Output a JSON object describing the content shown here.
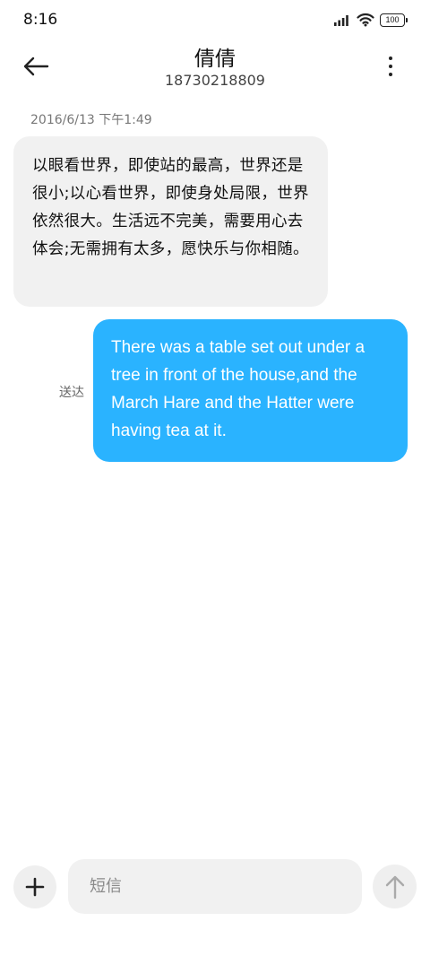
{
  "status_bar": {
    "time": "8:16",
    "battery": "100",
    "icons": [
      "signal-icon",
      "wifi-icon",
      "battery-icon"
    ]
  },
  "header": {
    "contact_name": "倩倩",
    "phone_number": "18730218809",
    "icons": [
      "back-arrow-icon",
      "more-vertical-icon"
    ]
  },
  "conversation": {
    "timestamp": "2016/6/13 下午1:49",
    "incoming_message": "以眼看世界，即使站的最高，世界还是很小;以心看世界，即使身处局限，世界依然很大。生活远不完美，需要用心去体会;无需拥有太多，愿快乐与你相随。",
    "outgoing_message": "There was a table set out under a tree in front of the house,and the March Hare and the Hatter were having tea at it.",
    "outgoing_status": "送达",
    "incoming_bubble_color": "#f1f1f1",
    "outgoing_bubble_color": "#2ab3ff"
  },
  "composer": {
    "placeholder": "短信",
    "value": "",
    "icons": [
      "plus-icon",
      "send-arrow-icon"
    ]
  }
}
